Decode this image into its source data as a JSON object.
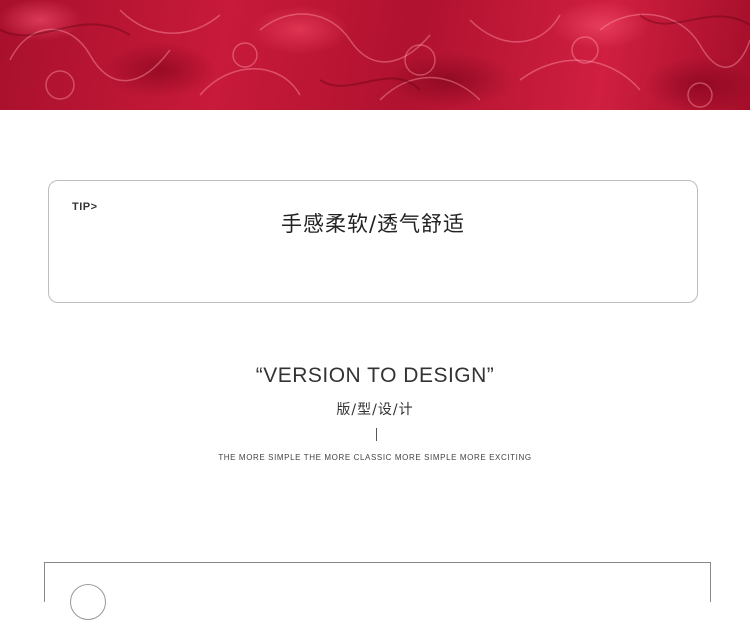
{
  "tip": {
    "label": "TIP>",
    "text": "手感柔软/透气舒适"
  },
  "design_section": {
    "title": "“VERSION TO DESIGN”",
    "subtitle": "版/型/设/计",
    "tagline": "THE MORE SIMPLE THE MORE CLASSIC MORE SIMPLE MORE EXCITING"
  },
  "colors": {
    "hero_red": "#c81a3a",
    "border": "#bdbdbd",
    "text": "#333333"
  }
}
